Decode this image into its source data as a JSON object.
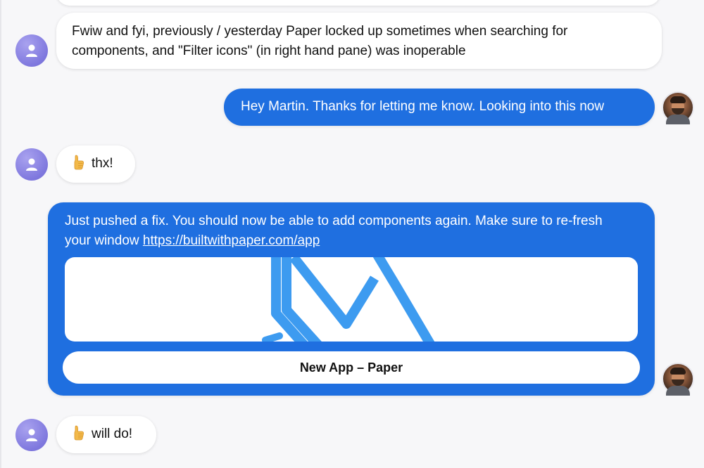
{
  "messages": [
    {
      "sender": "bot",
      "text": "Fwiw and fyi, previously / yesterday Paper locked up sometimes when searching for components, and \"Filter icons\" (in right hand pane) was inoperable"
    },
    {
      "sender": "user",
      "text": "Hey Martin. Thanks for letting me know. Looking into this now"
    },
    {
      "sender": "bot",
      "emoji": "thumbs-up",
      "text": "thx!"
    },
    {
      "sender": "user",
      "text": "Just pushed a fix. You should now be able to add components again. Make sure to re-fresh your window",
      "link": "https://builtwithpaper.com/app",
      "card": {
        "button_label": "New App – Paper",
        "preview_logo": "paper-logo-icon"
      }
    },
    {
      "sender": "bot",
      "emoji": "thumbs-up",
      "text": "will do!"
    }
  ],
  "colors": {
    "user_bubble": "#1f6fe0",
    "bot_bubble": "#ffffff",
    "background": "#f7f7f9",
    "bot_avatar": "#7f78de",
    "logo": "#3d9bf0"
  }
}
